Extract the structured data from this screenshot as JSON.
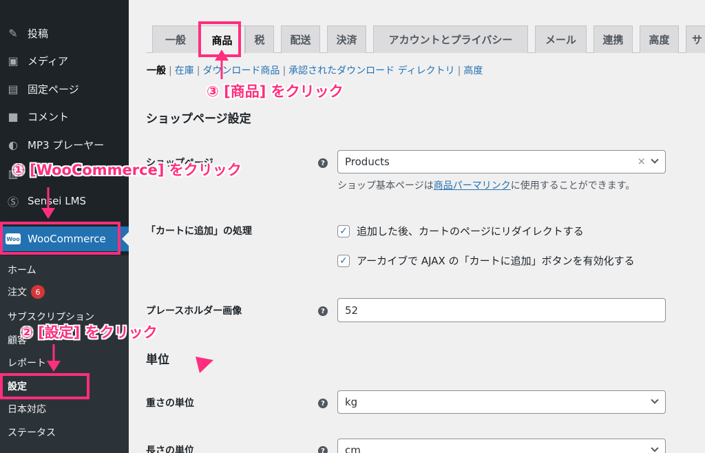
{
  "sidebar": {
    "items": [
      {
        "label": "投稿",
        "icon": "pin-icon"
      },
      {
        "label": "メディア",
        "icon": "media-icon"
      },
      {
        "label": "固定ページ",
        "icon": "page-icon"
      },
      {
        "label": "コメント",
        "icon": "comment-icon"
      },
      {
        "label": "MP3 プレーヤー",
        "icon": "player-icon"
      },
      {
        "label": "",
        "icon": "form-icon"
      },
      {
        "label": "Sensei LMS",
        "icon": "sensei-icon"
      }
    ],
    "active": {
      "label": "WooCommerce",
      "icon": "woo-icon",
      "logo_text": "Woo"
    },
    "submenu": [
      {
        "label": "ホーム"
      },
      {
        "label": "注文",
        "badge": "6"
      },
      {
        "label": "サブスクリプション"
      },
      {
        "label": "顧客"
      },
      {
        "label": "レポート"
      },
      {
        "label": "設定"
      },
      {
        "label": "日本対応"
      },
      {
        "label": "ステータス"
      }
    ]
  },
  "tabs": [
    "一般",
    "商品",
    "税",
    "配送",
    "決済",
    "アカウントとプライバシー",
    "メール",
    "連携",
    "高度",
    "サ"
  ],
  "active_tab": "商品",
  "subsub": {
    "current": "一般",
    "links": [
      "在庫",
      "ダウンロード商品",
      "承認されたダウンロード ディレクトリ",
      "高度"
    ]
  },
  "form": {
    "shop_section_title": "ショップページ設定",
    "shop_page": {
      "label": "ショップページ",
      "value": "Products",
      "desc_prefix": "ショップ基本ページは",
      "desc_link": "商品パーマリンク",
      "desc_suffix": "に使用することができます。"
    },
    "cart": {
      "label": "「カートに追加」の処理",
      "options": [
        "追加した後、カートのページにリダイレクトする",
        "アーカイブで AJAX の「カートに追加」ボタンを有効化する"
      ]
    },
    "placeholder": {
      "label": "プレースホルダー画像",
      "value": "52"
    },
    "units_section_title": "単位",
    "weight": {
      "label": "重さの単位",
      "value": "kg"
    },
    "length": {
      "label": "長さの単位",
      "value": "cm"
    }
  },
  "annotations": {
    "step1": "① [WooCommerce] をクリック",
    "step2": "② [設定] をクリック",
    "step3": "③ [商品] をクリック"
  },
  "colors": {
    "annotation": "#ff2e7e",
    "sidebar_bg": "#1d2327",
    "accent": "#2271b1"
  }
}
